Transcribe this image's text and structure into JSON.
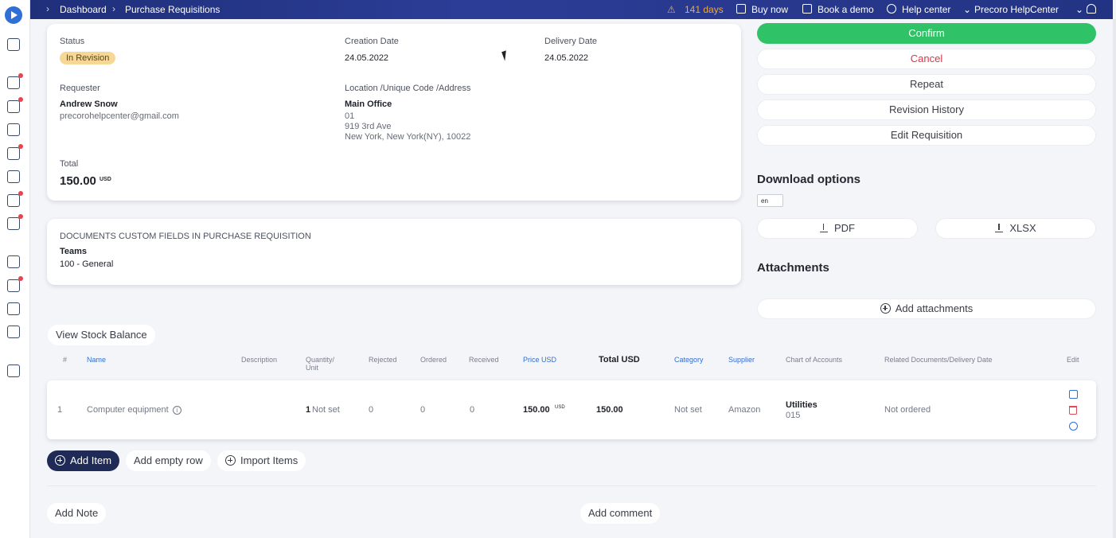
{
  "breadcrumb": {
    "items": [
      "Dashboard",
      "Purchase Requisitions"
    ]
  },
  "topbar": {
    "trial": "141 days",
    "buy_now": "Buy now",
    "book_demo": "Book a demo",
    "help_center": "Help center",
    "company": "Precoro HelpCenter"
  },
  "colors": {
    "accent": "#2f6fd6",
    "confirm": "#2fc266",
    "cancel": "#d9364a",
    "badge": "#f7d795",
    "topbar": "#233384"
  },
  "summary": {
    "status_label": "Status",
    "status_value": "In Revision",
    "creation_label": "Creation Date",
    "creation_value": "24.05.2022",
    "delivery_label": "Delivery Date",
    "delivery_value": "24.05.2022",
    "requester_label": "Requester",
    "requester_name": "Andrew Snow",
    "requester_email": "precorohelpcenter@gmail.com",
    "location_label": "Location /Unique Code /Address",
    "location_name": "Main Office",
    "location_code": "01",
    "location_street": "919 3rd Ave",
    "location_city": "New York, New York(NY), 10022",
    "total_label": "Total",
    "total_value": "150.00",
    "total_currency": "USD"
  },
  "custom_fields": {
    "title": "DOCUMENTS CUSTOM FIELDS IN PURCHASE REQUISITION",
    "field_label": "Teams",
    "field_value": "100 - General"
  },
  "actions": {
    "confirm": "Confirm",
    "cancel": "Cancel",
    "repeat": "Repeat",
    "revision_history": "Revision History",
    "edit": "Edit Requisition"
  },
  "download": {
    "title": "Download options",
    "language": "en",
    "pdf": "PDF",
    "xlsx": "XLSX"
  },
  "attachments": {
    "title": "Attachments",
    "add": "Add attachments"
  },
  "stock_balance": "View Stock Balance",
  "table": {
    "headers": {
      "num": "#",
      "name": "Name",
      "description": "Description",
      "quantity": "Quantity/",
      "unit": "Unit",
      "rejected": "Rejected",
      "ordered": "Ordered",
      "received": "Received",
      "price": "Price USD",
      "total": "Total USD",
      "category": "Category",
      "supplier": "Supplier",
      "chart": "Chart of Accounts",
      "related": "Related Documents/Delivery Date",
      "edit": "Edit"
    },
    "row": {
      "num": "1",
      "name": "Computer equipment",
      "qty": "1",
      "unit": "Not set",
      "rejected": "0",
      "ordered": "0",
      "received": "0",
      "price": "150.00",
      "price_currency": "USD",
      "total": "150.00",
      "category": "Not set",
      "supplier": "Amazon",
      "chart_name": "Utilities",
      "chart_code": "015",
      "related": "Not ordered"
    }
  },
  "bottom": {
    "add_item": "Add Item",
    "add_empty_row": "Add empty row",
    "import_items": "Import Items",
    "add_note": "Add Note",
    "add_comment": "Add comment"
  }
}
